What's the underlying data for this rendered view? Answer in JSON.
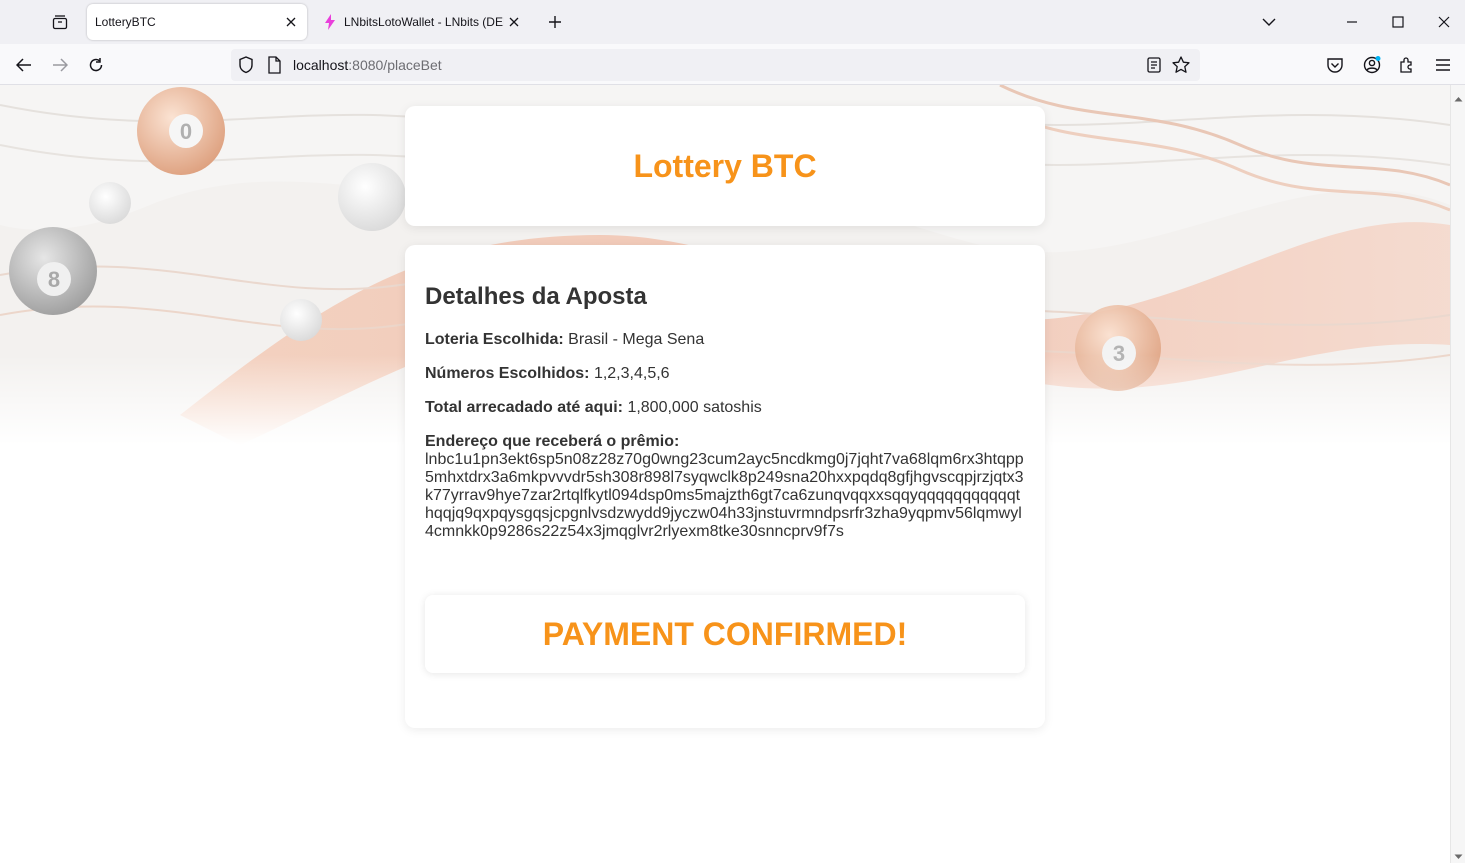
{
  "browser": {
    "tabs": [
      {
        "title": "LotteryBTC",
        "active": true
      },
      {
        "title": "LNbitsLotoWallet - LNbits (DEM",
        "active": false
      }
    ],
    "url_host": "localhost",
    "url_rest": ":8080/placeBet"
  },
  "header": {
    "title": "Lottery BTC"
  },
  "details": {
    "title": "Detalhes da Aposta",
    "lottery_label": "Loteria Escolhida:",
    "lottery_value": "Brasil - Mega Sena",
    "numbers_label": "Números Escolhidos:",
    "numbers_value": "1,2,3,4,5,6",
    "total_label": "Total arrecadado até aqui:",
    "total_value": "1,800,000 satoshis",
    "address_label": "Endereço que receberá o prêmio:",
    "address_value": "lnbc1u1pn3ekt6sp5n08z28z70g0wng23cum2ayc5ncdkmg0j7jqht7va68lqm6rx3htqpp5mhxtdrx3a6mkpvvvdr5sh308r898l7syqwclk8p249sna20hxxpqdq8gfjhgvscqpjrzjqtx3k77yrrav9hye7zar2rtqlfkytl094dsp0ms5majzth6gt7ca6zunqvqqxxsqqyqqqqqqqqqqqthqqjq9qxpqysgqsjcpgnlvsdzwydd9jyczw04h33jnstuvrmndpsrfr3zha9yqpmv56lqmwyl4cmnkk0p9286s22z54x3jmqglvr2rlyexm8tke30snncprv9f7s",
    "payment_status": "PAYMENT CONFIRMED!"
  },
  "colors": {
    "accent": "#f7931a"
  }
}
